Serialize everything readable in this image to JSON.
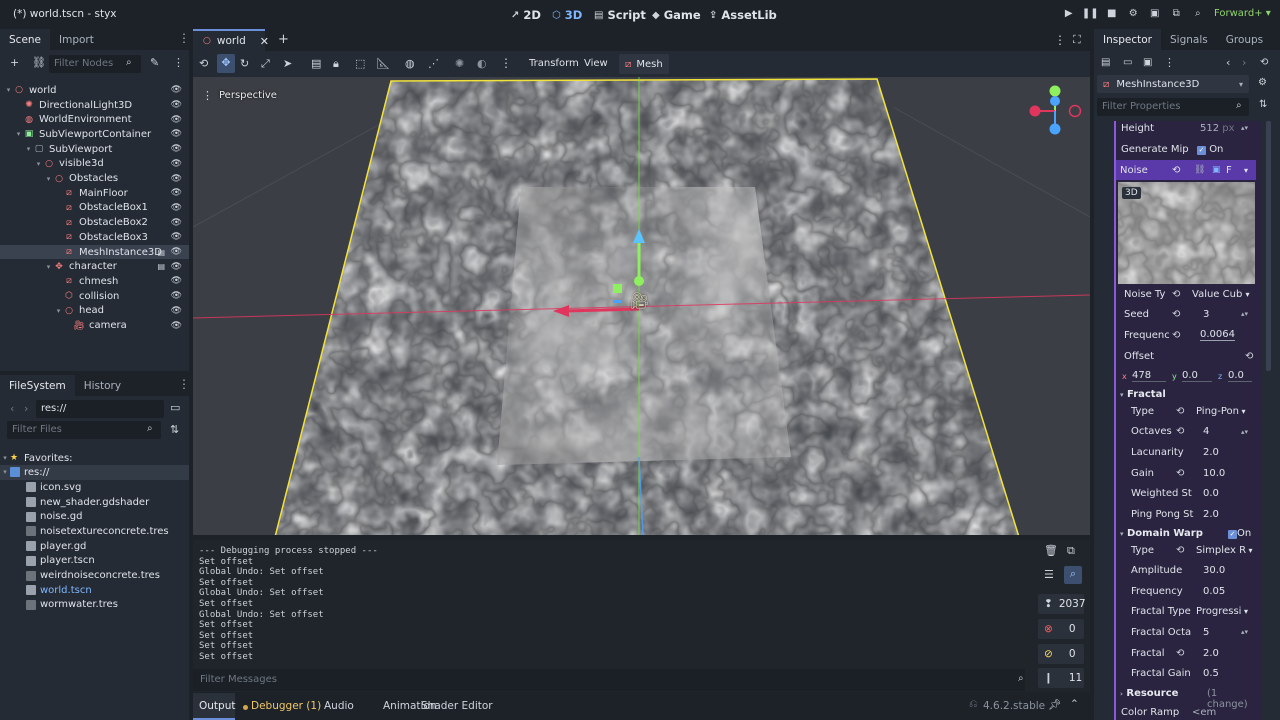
{
  "window": {
    "title": "(*) world.tscn - styx",
    "renderer": "Forward+"
  },
  "workspaces": [
    {
      "label": "2D",
      "icon": "2d-icon"
    },
    {
      "label": "3D",
      "icon": "3d-icon",
      "active": true
    },
    {
      "label": "Script",
      "icon": "script-icon"
    },
    {
      "label": "Game",
      "icon": "game-icon"
    },
    {
      "label": "AssetLib",
      "icon": "assetlib-icon"
    }
  ],
  "scene_dock": {
    "tabs": [
      "Scene",
      "Import"
    ],
    "filter_placeholder": "Filter Nodes",
    "nodes": [
      {
        "label": "world",
        "depth": 0,
        "color": "red",
        "arrow": "▾"
      },
      {
        "label": "DirectionalLight3D",
        "depth": 1,
        "color": "red",
        "arrow": ""
      },
      {
        "label": "WorldEnvironment",
        "depth": 1,
        "color": "red",
        "arrow": ""
      },
      {
        "label": "SubViewportContainer",
        "depth": 1,
        "color": "green",
        "arrow": "▾"
      },
      {
        "label": "SubViewport",
        "depth": 2,
        "color": "grey",
        "arrow": "▾"
      },
      {
        "label": "visible3d",
        "depth": 3,
        "color": "red",
        "arrow": "▾"
      },
      {
        "label": "Obstacles",
        "depth": 4,
        "color": "red",
        "arrow": "▾"
      },
      {
        "label": "MainFloor",
        "depth": 5,
        "color": "red",
        "arrow": ""
      },
      {
        "label": "ObstacleBox1",
        "depth": 5,
        "color": "red",
        "arrow": ""
      },
      {
        "label": "ObstacleBox2",
        "depth": 5,
        "color": "red",
        "arrow": ""
      },
      {
        "label": "ObstacleBox3",
        "depth": 5,
        "color": "red",
        "arrow": ""
      },
      {
        "label": "MeshInstance3D",
        "depth": 5,
        "color": "red",
        "arrow": "",
        "selected": true
      },
      {
        "label": "character",
        "depth": 4,
        "color": "red",
        "arrow": "▾"
      },
      {
        "label": "chmesh",
        "depth": 5,
        "color": "red",
        "arrow": ""
      },
      {
        "label": "collision",
        "depth": 5,
        "color": "red",
        "arrow": ""
      },
      {
        "label": "head",
        "depth": 5,
        "color": "red",
        "arrow": "▾"
      },
      {
        "label": "camera",
        "depth": 6,
        "color": "red",
        "arrow": ""
      }
    ]
  },
  "filesystem_dock": {
    "tabs": [
      "FileSystem",
      "History"
    ],
    "path": "res://",
    "filter_placeholder": "Filter Files",
    "favorites_label": "Favorites:",
    "root_label": "res://",
    "files": [
      {
        "name": "icon.svg",
        "color": "#9aa3ad"
      },
      {
        "name": "new_shader.gdshader",
        "color": "#9aa3ad"
      },
      {
        "name": "noise.gd",
        "color": "#9aa3ad"
      },
      {
        "name": "noisetextureconcrete.tres",
        "color": "#6d737b"
      },
      {
        "name": "player.gd",
        "color": "#9aa3ad"
      },
      {
        "name": "player.tscn",
        "color": "#9aa3ad"
      },
      {
        "name": "weirdnoiseconcrete.tres",
        "color": "#6d737b"
      },
      {
        "name": "world.tscn",
        "color": "#9aa3ad",
        "highlight": true
      },
      {
        "name": "wormwater.tres",
        "color": "#6d737b"
      }
    ]
  },
  "editor_tabs": {
    "scene_tab": "world",
    "add": "+"
  },
  "viewport_toolbar": {
    "transform": "Transform",
    "view": "View",
    "mesh": "Mesh"
  },
  "viewport": {
    "perspective_label": "Perspective"
  },
  "output": {
    "lines": [
      "--- Debugging process stopped ---",
      "Set offset",
      "Global Undo: Set offset",
      "Set offset",
      "Global Undo: Set offset",
      "Set offset",
      "Global Undo: Set offset",
      "Set offset",
      "Set offset",
      "Set offset",
      "Set offset"
    ],
    "filter_placeholder": "Filter Messages",
    "counts": {
      "messages": "2037",
      "errors": "0",
      "warnings": "0",
      "other": "11"
    }
  },
  "bottom_tabs": [
    "Output",
    "Debugger (1)",
    "Audio",
    "Animation",
    "Shader Editor"
  ],
  "version": "4.6.2.stable",
  "inspector": {
    "tabs": [
      "Inspector",
      "Signals",
      "Groups"
    ],
    "node_name": "MeshInstance3D",
    "filter_placeholder": "Filter Properties",
    "height_label": "Height",
    "height_value": "512",
    "height_unit": "px",
    "generate_mip_label": "Generate Mip",
    "generate_mip_value": "On",
    "noise_label": "Noise",
    "noise_badge": "F",
    "preview_label": "3D",
    "noise_type_label": "Noise Ty",
    "noise_type_value": "Value Cub",
    "seed_label": "Seed",
    "seed_value": "3",
    "frequency_label": "Frequenc",
    "frequency_value": "0.0064",
    "offset_label": "Offset",
    "offset": {
      "x_label": "x",
      "x": "478",
      "y_label": "y",
      "y": "0.0",
      "z_label": "z",
      "z": "0.0"
    },
    "fractal_section": "Fractal",
    "fractal": [
      {
        "label": "Type",
        "value": "Ping-Pon",
        "revert": true,
        "dropdown": true
      },
      {
        "label": "Octaves",
        "value": "4",
        "revert": true,
        "spin": true
      },
      {
        "label": "Lacunarity",
        "value": "2.0"
      },
      {
        "label": "Gain",
        "value": "10.0",
        "revert": true
      },
      {
        "label": "Weighted St",
        "value": "0.0"
      },
      {
        "label": "Ping Pong St",
        "value": "2.0"
      }
    ],
    "domain_warp_section": "Domain Warp",
    "domain_warp_value": "On",
    "domain_warp": [
      {
        "label": "Type",
        "value": "Simplex R",
        "revert": true,
        "dropdown": true
      },
      {
        "label": "Amplitude",
        "value": "30.0"
      },
      {
        "label": "Frequency",
        "value": "0.05"
      },
      {
        "label": "Fractal Type",
        "value": "Progressi",
        "dropdown": true
      },
      {
        "label": "Fractal Octa",
        "value": "5",
        "spin": true
      },
      {
        "label": "Fractal",
        "value": "2.0",
        "revert": true
      },
      {
        "label": "Fractal Gain",
        "value": "0.5"
      }
    ],
    "resource_section": "Resource",
    "resource_changes": "(1 change)",
    "color_ramp_label": "Color Ramp",
    "color_ramp_value": "<em"
  }
}
